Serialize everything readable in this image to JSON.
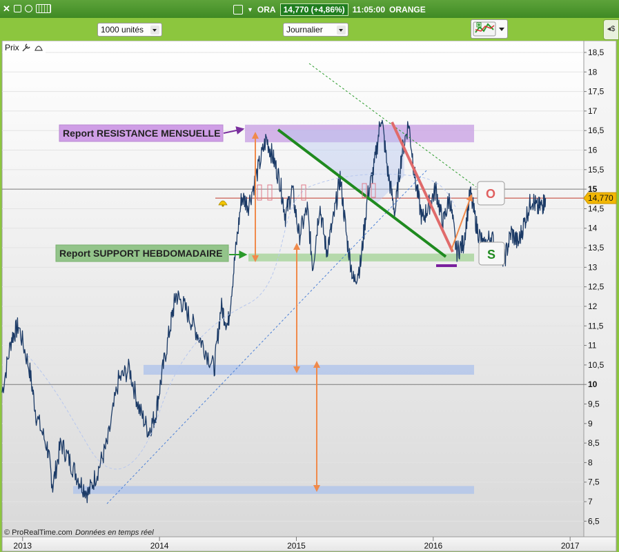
{
  "window": {
    "symbol": "ORA",
    "price_badge": "14,770 (+4,86%)",
    "time": "11:05:00",
    "name": "ORANGE"
  },
  "toolbar": {
    "units_select": "1000 unités",
    "period_select": "Journalier"
  },
  "panel": {
    "label": "Prix"
  },
  "copyright": {
    "brand": "© ProRealTime.com",
    "note": "Données en temps réel"
  },
  "annotations": {
    "resistance_label": "Report RESISTANCE MENSUELLE",
    "support_label": "Report SUPPORT HEBDOMADAIRE",
    "box_o": "O",
    "box_s": "S"
  },
  "colors": {
    "background_green": "#8cc63e",
    "price_line": "#1b3a66",
    "resistance_zone": "#c9a3e3",
    "support_zone": "#a6d39a",
    "blue_zone": "#b3c6ea",
    "trendline_green": "#1f8a1f",
    "trendline_red": "#e06b6b",
    "arrow_orange": "#f08a4b",
    "price_marker": "#f2b705"
  },
  "chart_data": {
    "type": "line",
    "title": "",
    "xlabel": "",
    "ylabel": "",
    "last_value": "14,770",
    "ylim": [
      6.1,
      18.8
    ],
    "xlim": [
      2012.85,
      2017.1
    ],
    "ytick_labels": [
      "18,5",
      "18",
      "17,5",
      "17",
      "16,5",
      "16",
      "15,5",
      "15",
      "14,5",
      "14",
      "13,5",
      "13",
      "12,5",
      "12",
      "11,5",
      "11",
      "10,5",
      "10",
      "9,5",
      "9",
      "8,5",
      "8",
      "7,5",
      "7",
      "6,5"
    ],
    "ytick_values": [
      18.5,
      18,
      17.5,
      17,
      16.5,
      16,
      15.5,
      15,
      14.5,
      14,
      13.5,
      13,
      12.5,
      12,
      11.5,
      11,
      10.5,
      10,
      9.5,
      9,
      8.5,
      8,
      7.5,
      7,
      6.5
    ],
    "xtick_labels": [
      "2013",
      "2014",
      "2015",
      "2016",
      "2017"
    ],
    "xtick_values": [
      2013,
      2014,
      2015,
      2016,
      2017
    ],
    "grid": true,
    "series": [
      {
        "x": [
          2012.85,
          2012.92,
          2012.97,
          2013.05,
          2013.1,
          2013.18,
          2013.22,
          2013.28,
          2013.35,
          2013.42,
          2013.48,
          2013.55,
          2013.62,
          2013.7,
          2013.78,
          2013.85,
          2013.92,
          2013.97,
          2014.02,
          2014.08,
          2014.12,
          2014.18,
          2014.25,
          2014.32,
          2014.4,
          2014.45,
          2014.5,
          2014.55,
          2014.6,
          2014.65,
          2014.72,
          2014.78,
          2014.83,
          2014.88,
          2014.92,
          2014.97,
          2015.02,
          2015.08,
          2015.12,
          2015.17,
          2015.22,
          2015.27,
          2015.32,
          2015.37,
          2015.42,
          2015.47,
          2015.52,
          2015.57,
          2015.62,
          2015.67,
          2015.72,
          2015.77,
          2015.82,
          2015.87,
          2015.92,
          2015.97,
          2016.02,
          2016.07,
          2016.12,
          2016.17,
          2016.22,
          2016.27,
          2016.32,
          2016.37,
          2016.42,
          2016.47,
          2016.52,
          2016.57,
          2016.62,
          2016.67,
          2016.72,
          2016.76,
          2016.8,
          2016.82
        ],
        "y": [
          9.8,
          11.2,
          11.5,
          10.4,
          9.2,
          8.4,
          7.4,
          8.5,
          8.0,
          7.5,
          7.2,
          7.8,
          8.5,
          10.1,
          10.4,
          9.4,
          8.8,
          9.2,
          10.3,
          11.5,
          12.3,
          12.0,
          11.5,
          11.0,
          10.4,
          12.0,
          11.5,
          13.2,
          14.8,
          14.6,
          15.5,
          16.3,
          15.8,
          15.2,
          14.3,
          15.0,
          13.8,
          14.5,
          13.0,
          14.6,
          13.4,
          14.2,
          15.3,
          13.7,
          12.6,
          13.1,
          14.8,
          15.6,
          16.9,
          15.4,
          14.4,
          15.9,
          16.7,
          15.2,
          14.2,
          14.6,
          15.0,
          14.1,
          14.8,
          13.4,
          13.6,
          14.9,
          14.0,
          13.5,
          13.8,
          13.4,
          13.2,
          13.9,
          13.6,
          14.2,
          14.77,
          14.5,
          14.6,
          14.77
        ]
      }
    ],
    "horizontal_levels": [
      {
        "name": "resistance_zone",
        "low": 16.2,
        "high": 16.65
      },
      {
        "name": "support_zone",
        "low": 13.15,
        "high": 13.35
      },
      {
        "name": "blue_zone_mid",
        "low": 10.25,
        "high": 10.5
      },
      {
        "name": "blue_zone_low",
        "low": 7.2,
        "high": 7.4
      },
      {
        "name": "last_price_line",
        "value": 14.77
      }
    ]
  }
}
